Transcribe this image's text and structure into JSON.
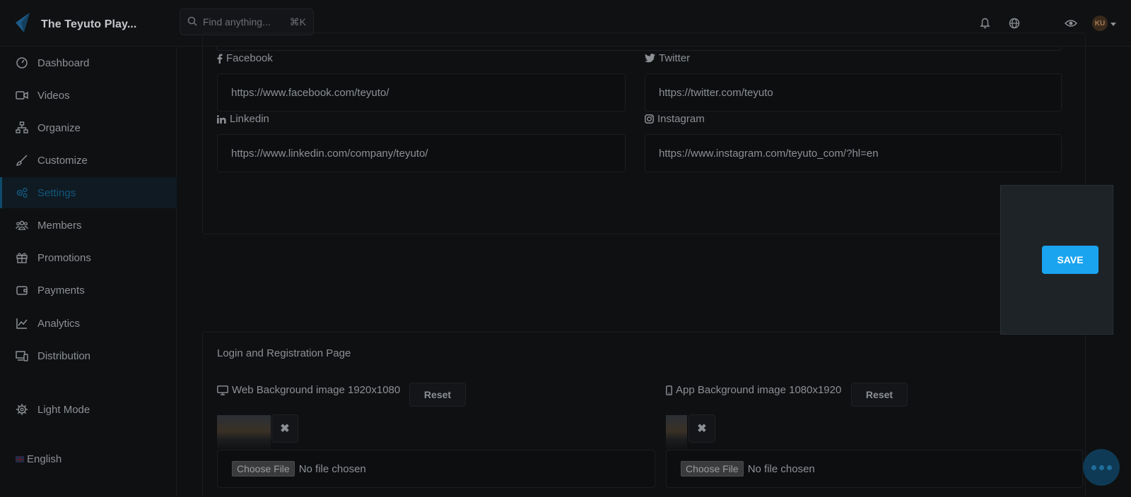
{
  "header": {
    "title": "The Teyuto Play...",
    "search_placeholder": "Find anything...",
    "search_shortcut": "⌘K",
    "avatar_initials": "KU"
  },
  "sidebar": {
    "items": [
      {
        "label": "Dashboard",
        "icon": "gauge-icon"
      },
      {
        "label": "Videos",
        "icon": "video-icon"
      },
      {
        "label": "Organize",
        "icon": "sitemap-icon"
      },
      {
        "label": "Customize",
        "icon": "brush-icon"
      },
      {
        "label": "Settings",
        "icon": "cogs-icon",
        "active": true
      },
      {
        "label": "Members",
        "icon": "users-icon"
      },
      {
        "label": "Promotions",
        "icon": "gift-icon"
      },
      {
        "label": "Payments",
        "icon": "wallet-icon"
      },
      {
        "label": "Analytics",
        "icon": "chart-icon"
      },
      {
        "label": "Distribution",
        "icon": "devices-icon"
      }
    ],
    "light_mode": "Light Mode",
    "language": "English"
  },
  "social": {
    "facebook": {
      "label": "Facebook",
      "value": "https://www.facebook.com/teyuto/"
    },
    "twitter": {
      "label": "Twitter",
      "value": "https://twitter.com/teyuto"
    },
    "linkedin": {
      "label": "Linkedin",
      "value": "https://www.linkedin.com/company/teyuto/"
    },
    "instagram": {
      "label": "Instagram",
      "value": "https://www.instagram.com/teyuto_com/?hl=en"
    }
  },
  "save_label": "SAVE",
  "login_section": {
    "title": "Login and Registration Page",
    "web_label": "Web Background image 1920x1080",
    "app_label": "App Background image 1080x1920",
    "reset_label": "Reset",
    "remove_label": "✖",
    "choose_file": "Choose File",
    "no_file": "No file chosen"
  },
  "colors": {
    "accent": "#1aa4f0",
    "active_nav": "#12577d"
  }
}
